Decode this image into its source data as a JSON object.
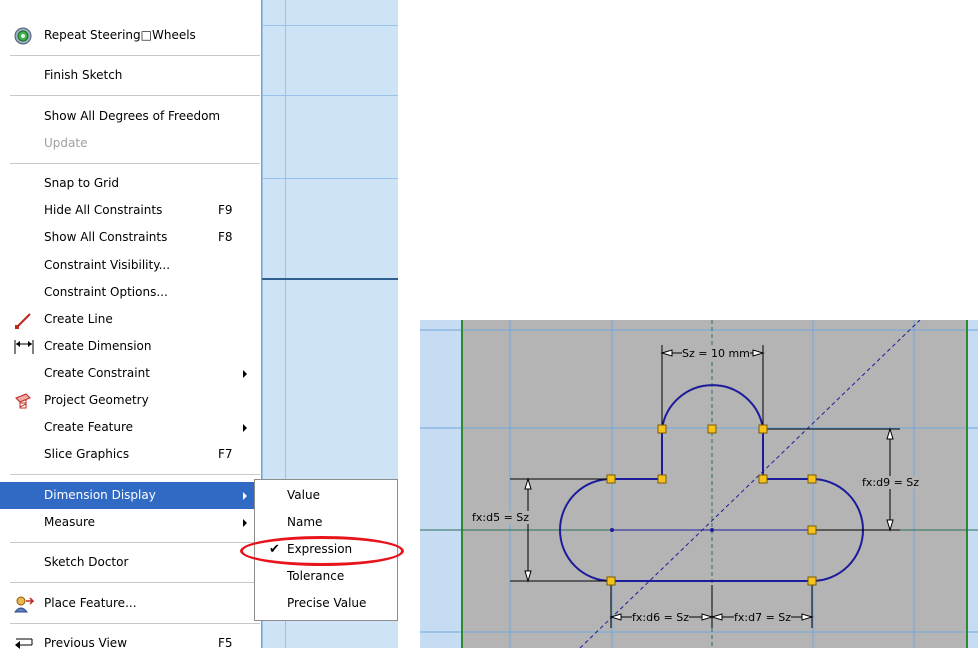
{
  "context_menu": {
    "items": [
      {
        "label": "Repeat Steering□Wheels",
        "icon": "steering-wheels-icon"
      },
      {
        "label": "Finish Sketch"
      },
      {
        "label": "Show All Degrees of Freedom"
      },
      {
        "label": "Update",
        "disabled": true
      },
      {
        "label": "Snap to Grid"
      },
      {
        "label": "Hide All Constraints",
        "shortcut": "F9"
      },
      {
        "label": "Show All Constraints",
        "shortcut": "F8"
      },
      {
        "label": "Constraint Visibility..."
      },
      {
        "label": "Constraint Options..."
      },
      {
        "label": "Create Line",
        "icon": "line-icon"
      },
      {
        "label": "Create Dimension",
        "icon": "dimension-icon"
      },
      {
        "label": "Create Constraint",
        "submenu": true
      },
      {
        "label": "Project Geometry",
        "icon": "project-geometry-icon"
      },
      {
        "label": "Create Feature",
        "submenu": true
      },
      {
        "label": "Slice Graphics",
        "shortcut": "F7"
      },
      {
        "label": "Dimension Display",
        "submenu": true,
        "highlighted": true
      },
      {
        "label": "Measure",
        "submenu": true
      },
      {
        "label": "Sketch Doctor"
      },
      {
        "label": "Place Feature...",
        "icon": "place-feature-icon"
      },
      {
        "label": "Previous View",
        "shortcut": "F5",
        "icon": "previous-view-icon"
      }
    ]
  },
  "dimension_display_submenu": {
    "items": [
      {
        "label": "Value"
      },
      {
        "label": "Name"
      },
      {
        "label": "Expression",
        "checked": true,
        "check_mark": "✔"
      },
      {
        "label": "Tolerance"
      },
      {
        "label": "Precise Value"
      }
    ],
    "annotation_color": "#e8141c"
  },
  "sketch": {
    "dimensions": {
      "top": "Sz = 10 mm",
      "right": "fx:d9 = Sz",
      "left": "fx:d5 = Sz",
      "bottom_left": "fx:d6 = Sz",
      "bottom_right": "fx:d7 = Sz"
    },
    "colors": {
      "profile": "#1c1c9a",
      "constraint_point": "#f4c21a",
      "sheet": "#b4b4b4",
      "grid": "#6fa8dc",
      "frame": "#2c8c2c",
      "background": "#c6dcf2"
    }
  }
}
